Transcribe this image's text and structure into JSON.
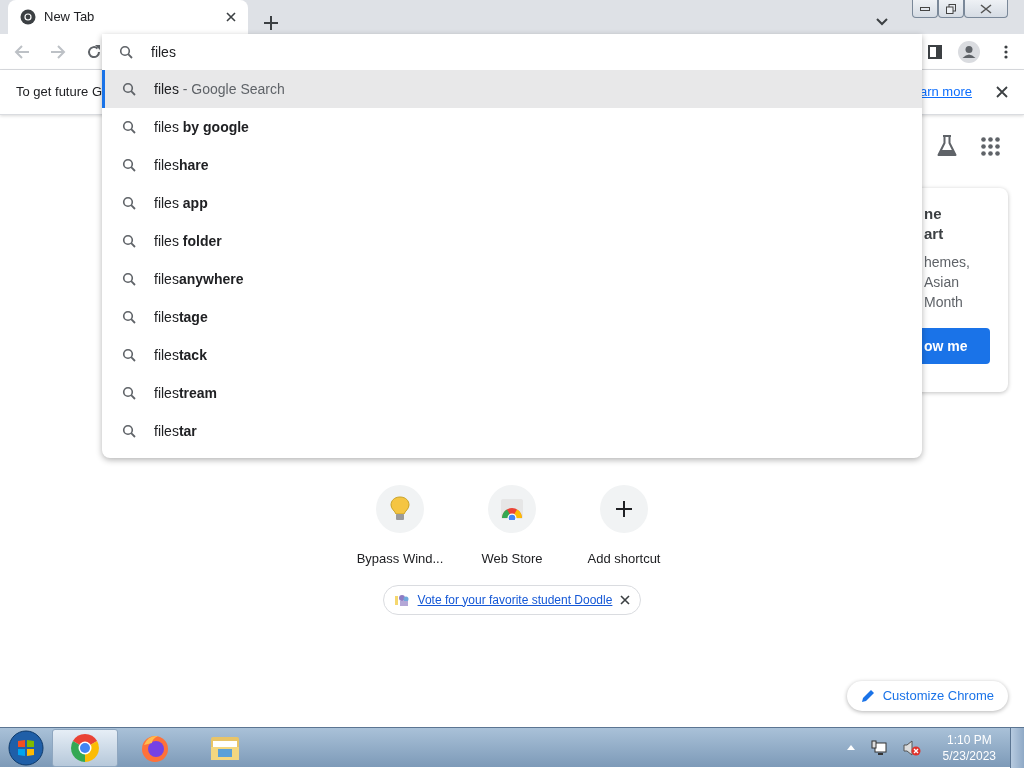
{
  "tabs": [
    {
      "title": "New Tab",
      "selected": true
    }
  ],
  "toolbar": {
    "back": {
      "disabled": true
    },
    "forward": {
      "disabled": true
    }
  },
  "omnibox": {
    "value": "files"
  },
  "suggestions": [
    {
      "text": "files",
      "detail": "- Google Search",
      "selected": true
    },
    {
      "text": "files **by google**",
      "selected": false
    },
    {
      "text": "files**hare**",
      "selected": false
    },
    {
      "text": "files **app**",
      "selected": false
    },
    {
      "text": "files **folder**",
      "selected": false
    },
    {
      "text": "files**anywhere**",
      "selected": false
    },
    {
      "text": "files**tage**",
      "selected": false
    },
    {
      "text": "files**tack**",
      "selected": false
    },
    {
      "text": "files**tream**",
      "selected": false
    },
    {
      "text": "files**tar**",
      "selected": false
    }
  ],
  "infobar": {
    "text": "To get future G",
    "link": "arn more"
  },
  "promo": {
    "title": [
      "ne",
      "art"
    ],
    "body": [
      "hemes,",
      "Asian",
      "Month"
    ],
    "button": "ow me"
  },
  "shortcuts": [
    {
      "label": "Bypass Wind...",
      "kind": "bulb"
    },
    {
      "label": "Web Store",
      "kind": "store"
    },
    {
      "label": "Add shortcut",
      "kind": "add"
    }
  ],
  "doodle_chip": {
    "text": "Vote for your favorite student Doodle"
  },
  "customize_button": "Customize Chrome",
  "taskbar": {
    "apps": [
      {
        "kind": "chrome",
        "selected": true
      },
      {
        "kind": "firefox",
        "selected": false
      },
      {
        "kind": "explorer",
        "selected": false
      }
    ],
    "time": "1:10 PM",
    "date": "5/23/2023"
  }
}
